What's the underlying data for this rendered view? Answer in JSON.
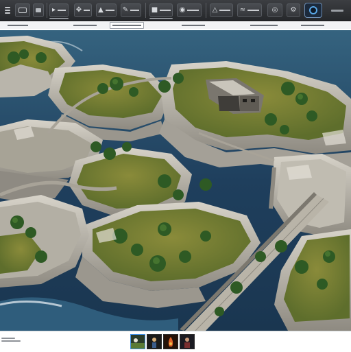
{
  "toolbar": {
    "buttons": [
      {
        "name": "menu-icon"
      },
      {
        "name": "viewport-icon"
      },
      {
        "name": "display-icon"
      },
      {
        "name": "select-tool-icon"
      },
      {
        "name": "move-tool-icon"
      },
      {
        "name": "terrain-tool-icon"
      },
      {
        "name": "paint-tool-icon"
      },
      {
        "name": "object-tool-icon"
      },
      {
        "name": "camera-icon"
      },
      {
        "name": "sculpt-tool-icon"
      },
      {
        "name": "water-tool-icon"
      },
      {
        "name": "eye-icon"
      },
      {
        "name": "settings-icon"
      }
    ],
    "active_tool": "render-icon"
  },
  "tabs": [
    {
      "name": "tab-scene",
      "active": false
    },
    {
      "name": "tab-terrain",
      "active": false
    },
    {
      "name": "tab-map",
      "active": true
    },
    {
      "name": "tab-assets",
      "active": false
    },
    {
      "name": "tab-layers",
      "active": false
    },
    {
      "name": "tab-render",
      "active": false
    }
  ],
  "viewport": {
    "content": "island-terrain-render",
    "colors": {
      "water": "#21405d",
      "water_light": "#2f6488",
      "rock": "#c7c3b9",
      "rock_shadow": "#8d8a82",
      "grass": "#6f7f34",
      "tree": "#2f5a24",
      "bridge": "#b9b4a8",
      "foam": "#eaf0f2"
    }
  },
  "statusbar": {
    "thumbnails": [
      {
        "name": "thumbnail-island",
        "selected": true
      },
      {
        "name": "thumbnail-figure",
        "selected": false
      },
      {
        "name": "thumbnail-fire",
        "selected": false
      },
      {
        "name": "thumbnail-character",
        "selected": false
      }
    ]
  }
}
